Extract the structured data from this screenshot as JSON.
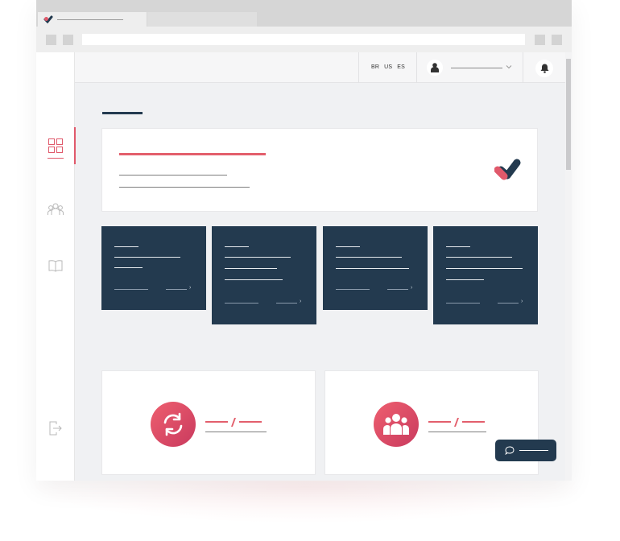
{
  "browser": {
    "tab_count": 2,
    "icons": {
      "favicon": "heart-logo-icon"
    }
  },
  "topbar": {
    "languages": [
      "BR",
      "US",
      "ES"
    ],
    "icons": {
      "avatar": "user-icon",
      "menu": "chevron-down-icon",
      "notifications": "bell-icon"
    }
  },
  "sidebar": {
    "items": [
      {
        "icon": "dashboard-grid-icon",
        "active": true
      },
      {
        "icon": "team-icon",
        "active": false
      },
      {
        "icon": "book-icon",
        "active": false
      }
    ],
    "logout_icon": "logout-icon"
  },
  "hero": {
    "logo_icon": "heart-logo-icon"
  },
  "cards_count": 4,
  "stats": [
    {
      "icon": "refresh-icon"
    },
    {
      "icon": "group-icon"
    }
  ],
  "chat": {
    "icon": "chat-bubble-icon"
  },
  "colors": {
    "accent": "#e35f6c",
    "navy": "#233a4f",
    "background": "#f0f1f3"
  }
}
